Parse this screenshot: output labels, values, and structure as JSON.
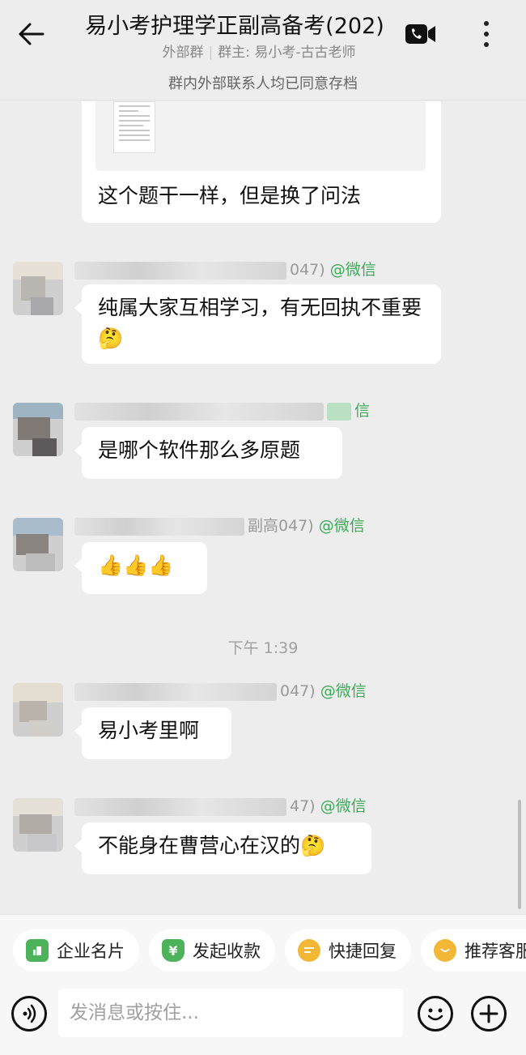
{
  "header": {
    "title": "易小考护理学正副高备考(202)",
    "subtitle_left": "外部群",
    "subtitle_sep": "|",
    "subtitle_right": "群主: 易小考-古古老师"
  },
  "notice": "群内外部联系人均已同意存档",
  "messages": [
    {
      "text": "这个题干一样，但是换了问法"
    },
    {
      "sender_suffix": "047)",
      "sender_tag": "@微信",
      "text": "纯属大家互相学习，有无回执不重要🤔"
    },
    {
      "sender_suffix": "",
      "sender_tag": "信",
      "text": "是哪个软件那么多原题"
    },
    {
      "sender_suffix": "副高047)",
      "sender_tag": "@微信",
      "text": "👍👍👍"
    },
    {
      "sender_suffix": "047)",
      "sender_tag": "@微信",
      "text": "易小考里啊"
    },
    {
      "sender_suffix": "47)",
      "sender_tag": "@微信",
      "text": "不能身在曹营心在汉的🤔"
    }
  ],
  "timestamp": "下午 1:39",
  "quick_actions": [
    {
      "label": "企业名片",
      "icon": "business-card-icon",
      "color": "#4cb35a"
    },
    {
      "label": "发起收款",
      "icon": "payment-icon",
      "color": "#4cb35a"
    },
    {
      "label": "快捷回复",
      "icon": "quick-reply-icon",
      "color": "#f2b735"
    },
    {
      "label": "推荐客服",
      "icon": "recommend-service-icon",
      "color": "#f2b735"
    }
  ],
  "input": {
    "placeholder": "发消息或按住..."
  },
  "colors": {
    "background": "#ededed",
    "wechat_green": "#3daa59"
  }
}
